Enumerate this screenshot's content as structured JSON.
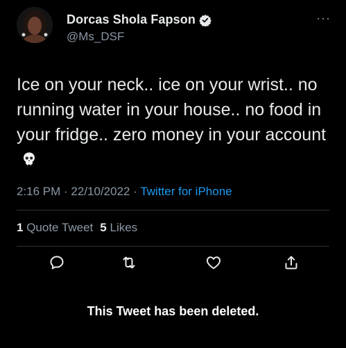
{
  "author": {
    "display_name": "Dorcas Shola Fapson",
    "handle": "@Ms_DSF",
    "verified": true,
    "avatar_icon": "profile-photo"
  },
  "more_label": "···",
  "tweet": {
    "text": "Ice on your neck.. ice on your wrist.. no running water in your house.. no food in your fridge.. zero money in your account",
    "emoji": "skull-emoji"
  },
  "meta": {
    "time": "2:16 PM",
    "separator": " · ",
    "date": "22/10/2022",
    "source": "Twitter for iPhone"
  },
  "stats": {
    "quote_count": "1",
    "quote_label": "Quote Tweet",
    "like_count": "5",
    "like_label": "Likes"
  },
  "actions": {
    "reply_icon": "reply-icon",
    "retweet_icon": "retweet-icon",
    "like_icon": "heart-icon",
    "share_icon": "share-icon"
  },
  "notice": {
    "deleted_text": "This Tweet has been deleted."
  },
  "colors": {
    "background": "#000000",
    "text": "#e7e9ea",
    "secondary": "#8b98a5",
    "accent": "#1d9bf0",
    "divider": "#2f3336"
  }
}
